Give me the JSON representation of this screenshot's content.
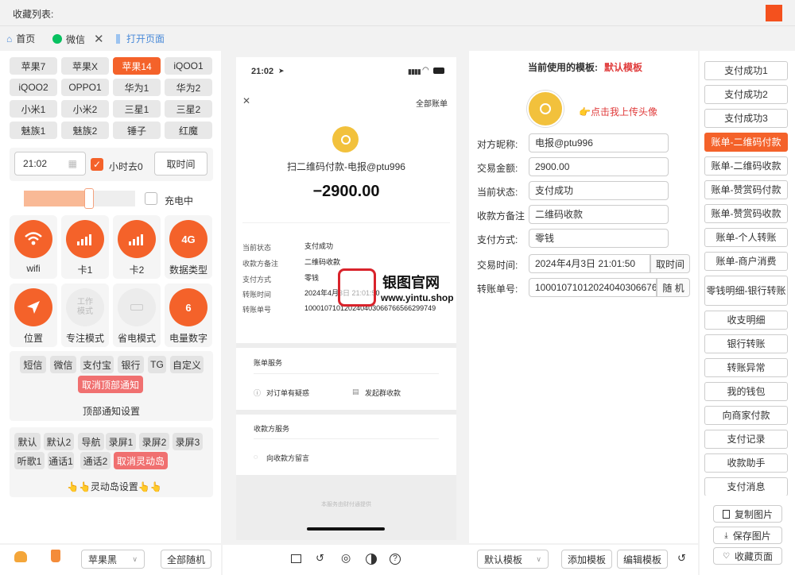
{
  "header": {
    "title": "收藏列表:"
  },
  "tabs": [
    {
      "label": "首页"
    },
    {
      "label": "微信"
    },
    {
      "label": "打开页面"
    }
  ],
  "devices": [
    [
      "苹果7",
      "苹果X",
      "苹果14",
      "iQOO1"
    ],
    [
      "iQOO2",
      "OPPO1",
      "华为1",
      "华为2"
    ],
    [
      "小米1",
      "小米2",
      "三星1",
      "三星2"
    ],
    [
      "魅族1",
      "魅族2",
      "锤子",
      "红魔"
    ]
  ],
  "time_panel": {
    "time": "21:02",
    "hours_ago": "小时去0",
    "cancel_time": "取时间",
    "charging": "充电中"
  },
  "status_tiles": [
    {
      "label": "wifi"
    },
    {
      "label": "卡1"
    },
    {
      "label": "卡2"
    },
    {
      "label": "数据类型",
      "icon_text": "4G"
    },
    {
      "label": "位置"
    },
    {
      "label": "专注模式",
      "icon_text": "工作模式"
    },
    {
      "label": "省电模式"
    },
    {
      "label": "电量数字",
      "icon_text": "6"
    }
  ],
  "notify": {
    "items": [
      "短信",
      "微信",
      "支付宝",
      "银行",
      "TG",
      "自定义"
    ],
    "cancel": "取消顶部通知",
    "settings": "顶部通知设置"
  },
  "island": {
    "items": [
      "默认",
      "默认2",
      "导航",
      "录屏1",
      "录屏2",
      "录屏3",
      "听歌1",
      "通话1",
      "通话2"
    ],
    "cancel": "取消灵动岛",
    "settings": "👆👆灵动岛设置👆👆"
  },
  "bottom_left": {
    "theme": "苹果黑",
    "random": "全部随机"
  },
  "phone": {
    "status_time": "21:02",
    "all_bills": "全部账单",
    "title": "扫二维码付款-电报@ptu996",
    "amount": "−2900.00",
    "details": [
      {
        "label": "当前状态",
        "value": "支付成功"
      },
      {
        "label": "收款方备注",
        "value": "二维码收款"
      },
      {
        "label": "支付方式",
        "value": "零钱"
      },
      {
        "label": "转账时间",
        "value": "2024年4月3日 21:01:50"
      },
      {
        "label": "转账单号",
        "value": "100010710120240403066766566299749"
      }
    ],
    "service1": {
      "title": "账单服务",
      "items": [
        "对订单有疑惑",
        "发起群收款"
      ]
    },
    "service2": {
      "title": "收款方服务",
      "items": [
        "向收款方留言"
      ]
    },
    "footer": "本服务由财付通提供"
  },
  "watermark": {
    "name": "银图官网",
    "url": "www.yintu.shop"
  },
  "form": {
    "template_label": "当前使用的模板:",
    "template_name": "默认模板",
    "upload_hint": "👉点击我上传头像",
    "fields": [
      {
        "label": "对方昵称:",
        "value": "电报@ptu996"
      },
      {
        "label": "交易金额:",
        "value": "2900.00"
      },
      {
        "label": "当前状态:",
        "value": "支付成功"
      },
      {
        "label": "收款方备注",
        "value": "二维码收款"
      },
      {
        "label": "支付方式:",
        "value": "零钱"
      },
      {
        "label": "交易时间:",
        "value": "2024年4月3日 21:01:50"
      },
      {
        "label": "转账单号:",
        "value": "100010710120240403066766"
      }
    ],
    "fetch_time": "取时间",
    "random": "随 机"
  },
  "bottom_right": {
    "template": "默认模板",
    "add": "添加模板",
    "edit": "编辑模板"
  },
  "templates": [
    "支付成功1",
    "支付成功2",
    "支付成功3",
    "账单-二维码付款",
    "账单-二维码收款",
    "账单-赞赏码付款",
    "账单-赞赏码收款",
    "账单-个人转账",
    "账单-商户消费",
    "零钱明细-银行转账",
    "收支明细",
    "银行转账",
    "转账异常",
    "我的钱包",
    "向商家付款",
    "支付记录",
    "收款助手",
    "支付消息"
  ],
  "actions": {
    "copy": "复制图片",
    "save": "保存图片",
    "fav": "收藏页面"
  },
  "colors": {
    "accent": "#f4622a",
    "green": "#07c160"
  }
}
